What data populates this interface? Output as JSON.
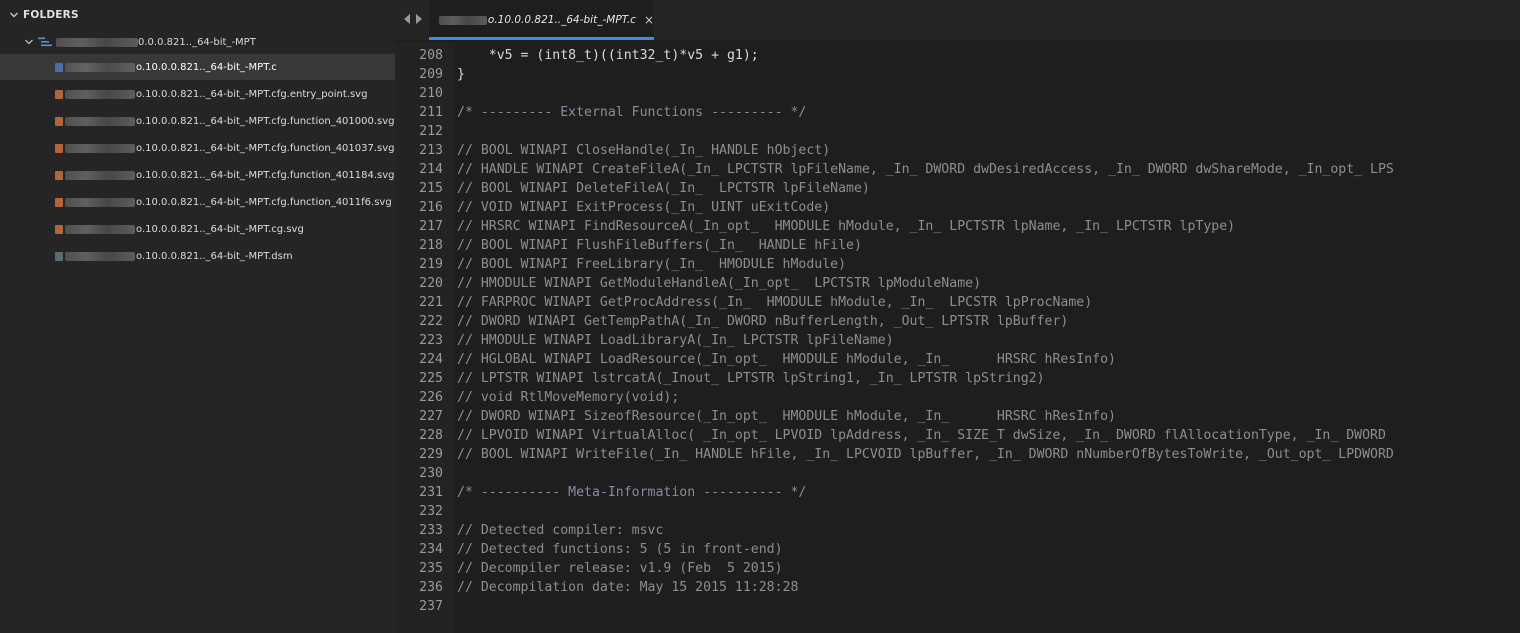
{
  "sidebar": {
    "header": "FOLDERS",
    "folder": {
      "name_suffix": "0.0.0.821.._64-bit_-MPT"
    },
    "files": [
      {
        "name": "o.10.0.0.821.._64-bit_-MPT.c",
        "active": true,
        "icon_color": "#4a6fa5"
      },
      {
        "name": "o.10.0.0.821.._64-bit_-MPT.cfg.entry_point.svg",
        "active": false,
        "icon_color": "#b5653a"
      },
      {
        "name": "o.10.0.0.821.._64-bit_-MPT.cfg.function_401000.svg",
        "active": false,
        "icon_color": "#b5653a"
      },
      {
        "name": "o.10.0.0.821.._64-bit_-MPT.cfg.function_401037.svg",
        "active": false,
        "icon_color": "#b5653a"
      },
      {
        "name": "o.10.0.0.821.._64-bit_-MPT.cfg.function_401184.svg",
        "active": false,
        "icon_color": "#b5653a"
      },
      {
        "name": "o.10.0.0.821.._64-bit_-MPT.cfg.function_4011f6.svg",
        "active": false,
        "icon_color": "#b5653a"
      },
      {
        "name": "o.10.0.0.821.._64-bit_-MPT.cg.svg",
        "active": false,
        "icon_color": "#b5653a"
      },
      {
        "name": "o.10.0.0.821.._64-bit_-MPT.dsm",
        "active": false,
        "icon_color": "#5c6a72"
      }
    ]
  },
  "tab": {
    "label": "o.10.0.0.821.._64-bit_-MPT.c",
    "close_glyph": "×",
    "accent": "#3e8fd8"
  },
  "editor": {
    "lines": [
      {
        "n": "208",
        "text": "    *v5 = (int8_t)((int32_t)*v5 + g1);",
        "kind": "plain"
      },
      {
        "n": "209",
        "text": "}",
        "kind": "plain"
      },
      {
        "n": "210",
        "text": "",
        "kind": "plain"
      },
      {
        "n": "211",
        "text": "/* --------- External Functions --------- */",
        "kind": "section"
      },
      {
        "n": "212",
        "text": "",
        "kind": "plain"
      },
      {
        "n": "213",
        "text": "// BOOL WINAPI CloseHandle(_In_ HANDLE hObject)",
        "kind": "comment"
      },
      {
        "n": "214",
        "text": "// HANDLE WINAPI CreateFileA(_In_ LPCTSTR lpFileName, _In_ DWORD dwDesiredAccess, _In_ DWORD dwShareMode, _In_opt_ LPS",
        "kind": "comment"
      },
      {
        "n": "215",
        "text": "// BOOL WINAPI DeleteFileA(_In_  LPCTSTR lpFileName)",
        "kind": "comment"
      },
      {
        "n": "216",
        "text": "// VOID WINAPI ExitProcess(_In_ UINT uExitCode)",
        "kind": "comment"
      },
      {
        "n": "217",
        "text": "// HRSRC WINAPI FindResourceA(_In_opt_  HMODULE hModule, _In_ LPCTSTR lpName, _In_ LPCTSTR lpType)",
        "kind": "comment"
      },
      {
        "n": "218",
        "text": "// BOOL WINAPI FlushFileBuffers(_In_  HANDLE hFile)",
        "kind": "comment"
      },
      {
        "n": "219",
        "text": "// BOOL WINAPI FreeLibrary(_In_  HMODULE hModule)",
        "kind": "comment"
      },
      {
        "n": "220",
        "text": "// HMODULE WINAPI GetModuleHandleA(_In_opt_  LPCTSTR lpModuleName)",
        "kind": "comment"
      },
      {
        "n": "221",
        "text": "// FARPROC WINAPI GetProcAddress(_In_  HMODULE hModule, _In_  LPCSTR lpProcName)",
        "kind": "comment"
      },
      {
        "n": "222",
        "text": "// DWORD WINAPI GetTempPathA(_In_ DWORD nBufferLength, _Out_ LPTSTR lpBuffer)",
        "kind": "comment"
      },
      {
        "n": "223",
        "text": "// HMODULE WINAPI LoadLibraryA(_In_ LPCTSTR lpFileName)",
        "kind": "comment"
      },
      {
        "n": "224",
        "text": "// HGLOBAL WINAPI LoadResource(_In_opt_  HMODULE hModule, _In_      HRSRC hResInfo)",
        "kind": "comment"
      },
      {
        "n": "225",
        "text": "// LPTSTR WINAPI lstrcatA(_Inout_ LPTSTR lpString1, _In_ LPTSTR lpString2)",
        "kind": "comment"
      },
      {
        "n": "226",
        "text": "// void RtlMoveMemory(void);",
        "kind": "comment"
      },
      {
        "n": "227",
        "text": "// DWORD WINAPI SizeofResource(_In_opt_  HMODULE hModule, _In_      HRSRC hResInfo)",
        "kind": "comment"
      },
      {
        "n": "228",
        "text": "// LPVOID WINAPI VirtualAlloc( _In_opt_ LPVOID lpAddress, _In_ SIZE_T dwSize, _In_ DWORD flAllocationType, _In_ DWORD",
        "kind": "comment"
      },
      {
        "n": "229",
        "text": "// BOOL WINAPI WriteFile(_In_ HANDLE hFile, _In_ LPCVOID lpBuffer, _In_ DWORD nNumberOfBytesToWrite, _Out_opt_ LPDWORD",
        "kind": "comment"
      },
      {
        "n": "230",
        "text": "",
        "kind": "plain"
      },
      {
        "n": "231",
        "text": "/* ---------- Meta-Information ---------- */",
        "kind": "section"
      },
      {
        "n": "232",
        "text": "",
        "kind": "plain"
      },
      {
        "n": "233",
        "text": "// Detected compiler: msvc",
        "kind": "comment"
      },
      {
        "n": "234",
        "text": "// Detected functions: 5 (5 in front-end)",
        "kind": "comment"
      },
      {
        "n": "235",
        "text": "// Decompiler release: v1.9 (Feb  5 2015)",
        "kind": "comment"
      },
      {
        "n": "236",
        "text": "// Decompilation date: May 15 2015 11:28:28",
        "kind": "comment"
      },
      {
        "n": "237",
        "text": "",
        "kind": "plain"
      }
    ]
  }
}
